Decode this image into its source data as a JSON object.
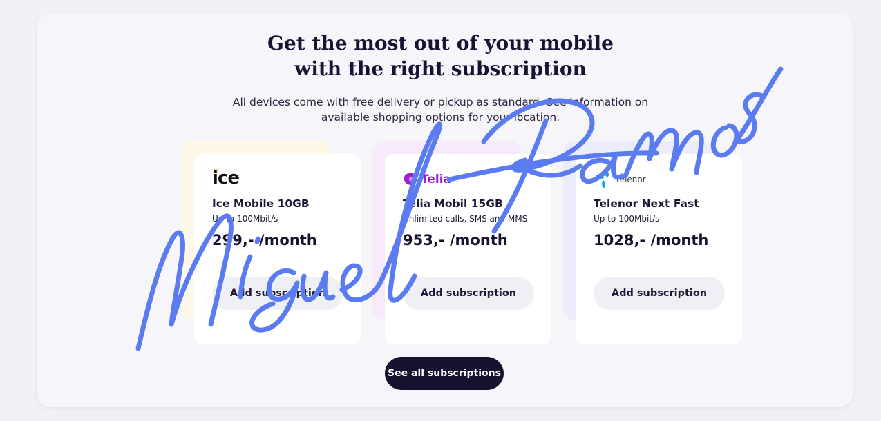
{
  "heading": {
    "line1": "Get the most out of your mobile",
    "line2": "with the right subscription"
  },
  "intro": {
    "line1": "All devices come with free delivery or pickup as standard. See information on",
    "line2": "available shopping options for your location."
  },
  "plans": [
    {
      "brand": "ice",
      "brand_color": "#111111",
      "name": "Ice Mobile 10GB",
      "subtitle": "Up to 100Mbit/s",
      "price": "299,- /month",
      "button_label": "Add subscription",
      "tint_color": "#fdf8e8"
    },
    {
      "brand": "Telia",
      "brand_color": "#9b1fd1",
      "name": "Telia Mobil 15GB",
      "subtitle": "Unlimited calls, SMS and MMS",
      "price": "953,- /month",
      "button_label": "Add subscription",
      "tint_color": "#f7ebfb"
    },
    {
      "brand": "telenor",
      "brand_color": "#00a9e6",
      "name": "Telenor Next Fast",
      "subtitle": "Up to 100Mbit/s",
      "price": "1028,- /month",
      "button_label": "Add subscription",
      "tint_color": "#ececfc"
    }
  ],
  "see_all_label": "See all subscriptions",
  "watermark": {
    "text": "Miguel Ramos",
    "color": "#5b7cf0"
  }
}
